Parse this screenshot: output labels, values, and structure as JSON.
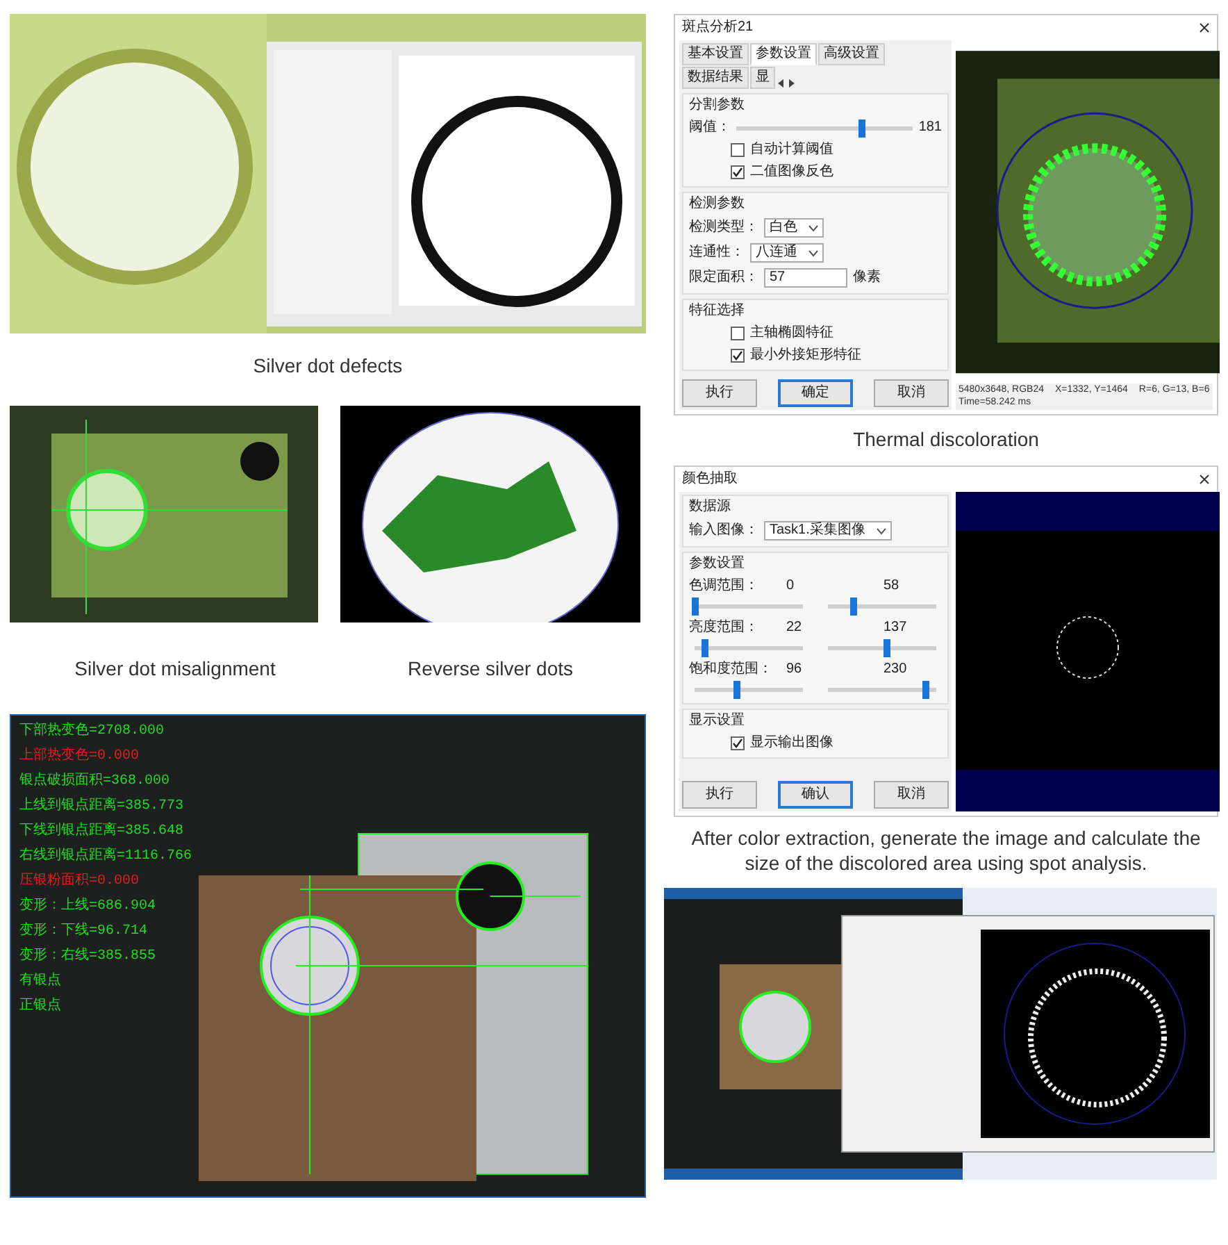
{
  "silver_dot_defects": {
    "caption": "Silver dot defects"
  },
  "thermal_discoloration": {
    "dialog": {
      "title": "斑点分析21",
      "tabs": [
        {
          "label": "基本设置",
          "selected": false
        },
        {
          "label": "参数设置",
          "selected": true
        },
        {
          "label": "高级设置",
          "selected": false
        },
        {
          "label": "数据结果",
          "selected": false
        },
        {
          "label": "显",
          "selected": false
        }
      ],
      "groups": [
        {
          "title": "分割参数",
          "rows": [
            {
              "kind": "slider",
              "label": "阈值：",
              "level": 0.71,
              "reading": "181"
            },
            {
              "kind": "checkbox",
              "label": "自动计算阈值",
              "checked": false
            },
            {
              "kind": "checkbox",
              "label": "二值图像反色",
              "checked": true
            }
          ]
        },
        {
          "title": "检测参数",
          "rows": [
            {
              "kind": "select",
              "label": "检测类型：",
              "value": "白色"
            },
            {
              "kind": "select",
              "label": "连通性：",
              "value": "八连通"
            },
            {
              "kind": "spin",
              "label": "限定面积：",
              "value": "57",
              "unit": "像素"
            }
          ]
        },
        {
          "title": "特征选择",
          "rows": [
            {
              "kind": "checkbox",
              "label": "主轴椭圆特征",
              "checked": false
            },
            {
              "kind": "checkbox",
              "label": "最小外接矩形特征",
              "checked": true
            }
          ]
        }
      ],
      "buttons": [
        {
          "label": "执行",
          "default": false
        },
        {
          "label": "确定",
          "default": true
        },
        {
          "label": "取消",
          "default": false
        }
      ],
      "status_bar": [
        "5480x3648, RGB24",
        "X=1332, Y=1464",
        "R=6, G=13, B=6",
        "Time=58.242 ms"
      ]
    },
    "caption": "Thermal discoloration"
  },
  "silver_dot_misalignment": {
    "caption": "Silver dot misalignment"
  },
  "reverse_silver_dots": {
    "caption": "Reverse silver dots"
  },
  "color_extraction": {
    "dialog": {
      "title": "颜色抽取",
      "groups": [
        {
          "title": "数据源",
          "rows": [
            {
              "kind": "select",
              "label": "输入图像：",
              "value": "Task1.采集图像"
            }
          ]
        },
        {
          "title": "参数设置",
          "rows": [
            {
              "kind": "range",
              "label": "色调范围：",
              "low": {
                "reading": "0",
                "level": 0.0
              },
              "high": {
                "reading": "58",
                "level": 0.23
              }
            },
            {
              "kind": "range",
              "label": "亮度范围：",
              "low": {
                "reading": "22",
                "level": 0.09
              },
              "high": {
                "reading": "137",
                "level": 0.54
              }
            },
            {
              "kind": "range",
              "label": "饱和度范围：",
              "low": {
                "reading": "96",
                "level": 0.38
              },
              "high": {
                "reading": "230",
                "level": 0.9
              }
            }
          ]
        },
        {
          "title": "显示设置",
          "rows": [
            {
              "kind": "checkbox",
              "label": "显示输出图像",
              "checked": true
            }
          ]
        }
      ],
      "buttons": [
        {
          "label": "执行",
          "default": false
        },
        {
          "label": "确认",
          "default": true
        },
        {
          "label": "取消",
          "default": false
        }
      ]
    },
    "caption": "After color extraction, generate the image and calculate the size of the discolored area using spot analysis."
  },
  "measurement_result": {
    "overlay_lines": [
      {
        "text": "下部热变色=2708.000",
        "color": "#22dd22"
      },
      {
        "text": "上部热变色=0.000",
        "color": "#dd2222"
      },
      {
        "text": "银点破损面积=368.000",
        "color": "#22dd22"
      },
      {
        "text": "上线到银点距离=385.773",
        "color": "#22dd22"
      },
      {
        "text": "下线到银点距离=385.648",
        "color": "#22dd22"
      },
      {
        "text": "右线到银点距离=1116.766",
        "color": "#22dd22"
      },
      {
        "text": "压银粉面积=0.000",
        "color": "#dd2222"
      },
      {
        "text": "变形：上线=686.904",
        "color": "#22dd22"
      },
      {
        "text": "变形：下线=96.714",
        "color": "#22dd22"
      },
      {
        "text": "变形：右线=385.855",
        "color": "#22dd22"
      },
      {
        "text": "有银点",
        "color": "#22dd22"
      },
      {
        "text": "正银点",
        "color": "#22dd22"
      }
    ]
  }
}
